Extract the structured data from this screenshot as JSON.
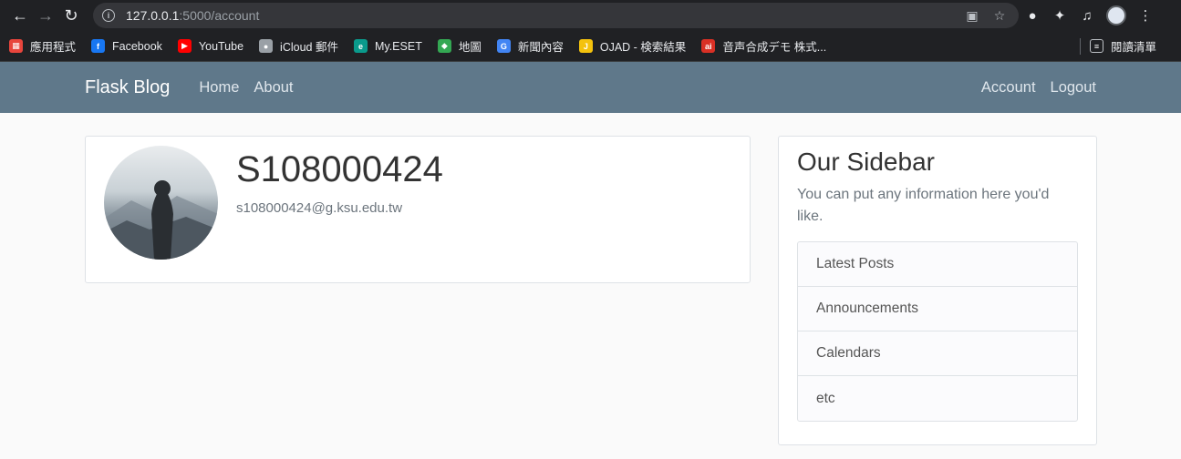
{
  "browser": {
    "url_host": "127.0.0.1",
    "url_path": ":5000/account",
    "bookmarks": [
      {
        "label": "應用程式",
        "icon": "apps-grid-icon",
        "color": "#e8453c"
      },
      {
        "label": "Facebook",
        "icon": "facebook-icon",
        "color": "#1877f2"
      },
      {
        "label": "YouTube",
        "icon": "youtube-icon",
        "color": "#ff0000"
      },
      {
        "label": "iCloud 郵件",
        "icon": "apple-icon",
        "color": "#9aa0a6"
      },
      {
        "label": "My.ESET",
        "icon": "eset-icon",
        "color": "#0a9a8c"
      },
      {
        "label": "地圖",
        "icon": "maps-icon",
        "color": "#34a853"
      },
      {
        "label": "新聞內容",
        "icon": "news-icon",
        "color": "#4285f4"
      },
      {
        "label": "OJAD - 検索結果",
        "icon": "ojad-icon",
        "color": "#f4c20d"
      },
      {
        "label": "音声合成デモ 株式...",
        "icon": "ai-icon",
        "color": "#d93025"
      }
    ],
    "reading_list": "閱讀清單"
  },
  "navbar": {
    "brand": "Flask Blog",
    "left_links": [
      "Home",
      "About"
    ],
    "right_links": [
      "Account",
      "Logout"
    ],
    "color": "#5f788a"
  },
  "profile": {
    "username": "S108000424",
    "email": "s108000424@g.ksu.edu.tw"
  },
  "sidebar": {
    "title": "Our Sidebar",
    "text": "You can put any information here you'd like.",
    "items": [
      "Latest Posts",
      "Announcements",
      "Calendars",
      "etc"
    ]
  }
}
